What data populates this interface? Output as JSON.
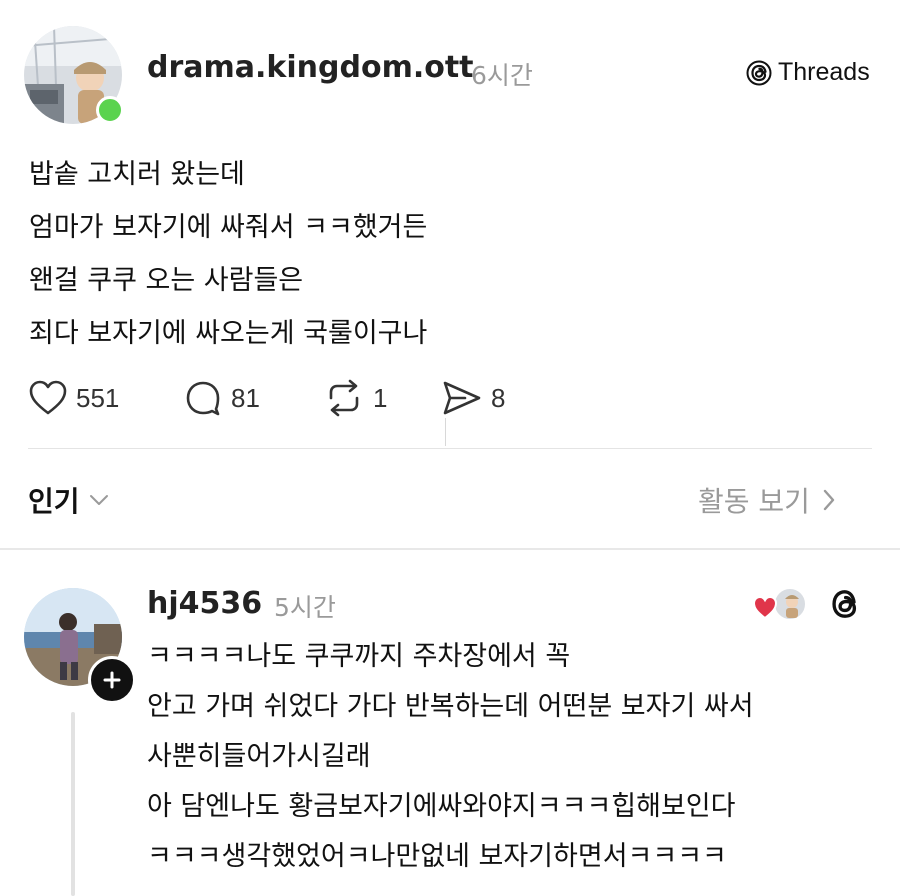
{
  "post": {
    "username": "drama.kingdom.ott",
    "time": "6시간",
    "brand": "Threads",
    "lines": [
      "밥솥 고치러 왔는데",
      "엄마가 보자기에 싸줘서 ㅋㅋ했거든",
      "왠걸 쿠쿠 오는 사람들은",
      "죄다 보자기에 싸오는게 국룰이구나"
    ],
    "stats": {
      "likes": "551",
      "comments": "81",
      "reposts": "1",
      "shares": "8"
    }
  },
  "sort": {
    "label": "인기",
    "activity": "활동 보기"
  },
  "reply": {
    "username": "hj4536",
    "time": "5시간",
    "lines": [
      "ㅋㅋㅋㅋ나도 쿠쿠까지 주차장에서 꼭",
      "안고 가며 쉬었다 가다 반복하는데 어떤분 보자기 싸서",
      "사뿐히들어가시길래",
      "아 담엔나도 황금보자기에싸와야지ㅋㅋㅋ힙해보인다",
      "ㅋㅋㅋ생각했었어ㅋ나만없네 보자기하면서ㅋㅋㅋㅋ"
    ]
  },
  "colors": {
    "online": "#5ad34e",
    "heart": "#e0354a",
    "muted": "#9a9a9a"
  },
  "icons": [
    "heart-icon",
    "comment-icon",
    "repost-icon",
    "share-icon",
    "threads-logo-icon",
    "chevron-down-icon",
    "chevron-right-icon",
    "plus-icon"
  ]
}
